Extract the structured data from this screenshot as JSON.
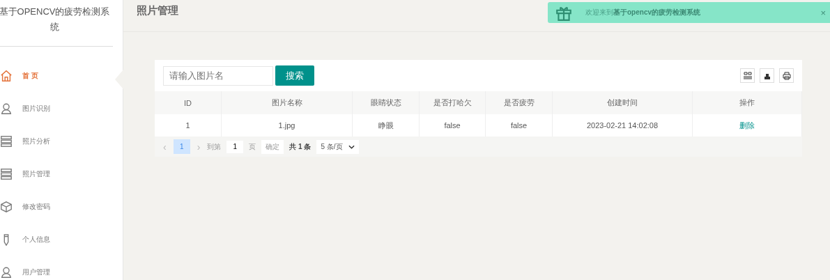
{
  "sidebar": {
    "title": "基于OPENCV的疲劳检测系统",
    "items": [
      {
        "label": "首 页",
        "kind": "home",
        "selected": true
      },
      {
        "label": "图片识别",
        "kind": "user",
        "selected": false
      },
      {
        "label": "照片分析",
        "kind": "list",
        "selected": false
      },
      {
        "label": "照片管理",
        "kind": "list",
        "selected": false
      },
      {
        "label": "修改密码",
        "kind": "box",
        "selected": false
      },
      {
        "label": "个人信息",
        "kind": "pen",
        "selected": false
      },
      {
        "label": "用户管理",
        "kind": "user",
        "selected": false
      }
    ]
  },
  "header": {
    "title": "照片管理"
  },
  "notice": {
    "text": "欢迎来到**基于opencv的疲劳检测系统**",
    "close": "×"
  },
  "search": {
    "placeholder": "请输入图片名",
    "button": "搜索"
  },
  "table": {
    "columns": [
      "ID",
      "图片名称",
      "眼睛状态",
      "是否打哈欠",
      "是否疲劳",
      "创建时间",
      "操作"
    ],
    "rows": [
      {
        "cells": [
          "1",
          "1.jpg",
          "睁眼",
          "false",
          "false",
          "2023-02-21 14:02:08"
        ],
        "action": "删除"
      }
    ]
  },
  "pagination": {
    "prev": "‹",
    "pages": [
      {
        "label": "1",
        "selected": true
      }
    ],
    "next": "›",
    "goto": "到第",
    "page_value": "1",
    "page_unit": "页",
    "confirm": "确定",
    "total": "共 1 条",
    "page_size": "5 条/页"
  }
}
